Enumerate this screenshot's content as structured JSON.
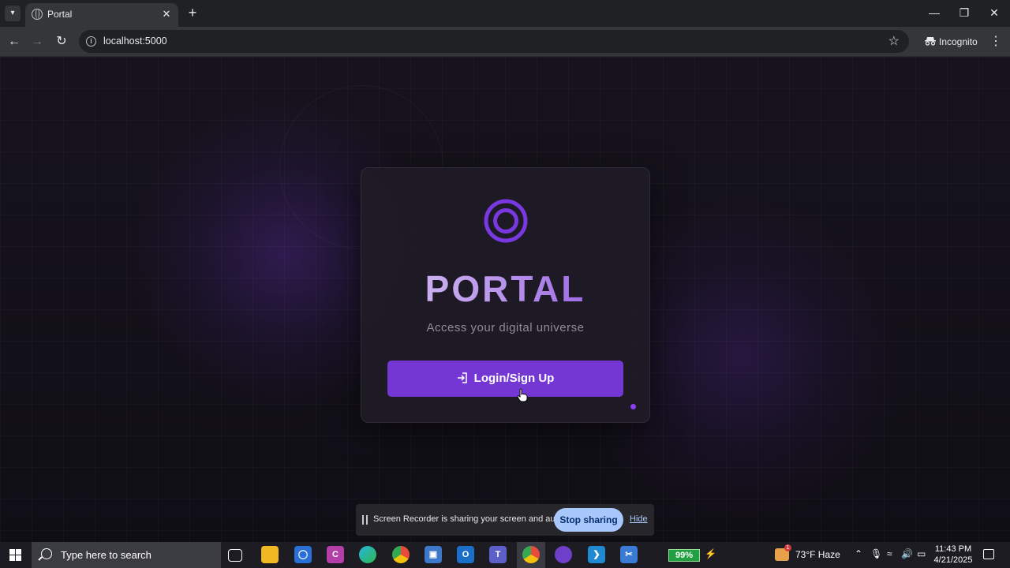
{
  "browser": {
    "tab_title": "Portal",
    "url": "localhost:5000",
    "incognito_label": "Incognito"
  },
  "page": {
    "brand": "PORTAL",
    "tagline": "Access your digital universe",
    "login_button": "Login/Sign Up",
    "accent_color": "#7437d4"
  },
  "share_bar": {
    "message": "Screen Recorder is sharing your screen and audio.",
    "stop_button": "Stop sharing",
    "hide_link": "Hide"
  },
  "taskbar": {
    "search_placeholder": "Type here to search",
    "battery": "99%",
    "weather": "73°F  Haze",
    "weather_badge": "1",
    "time": "11:43 PM",
    "date": "4/21/2025",
    "pinned_apps": [
      "task-view",
      "file-explorer",
      "defender",
      "c-app",
      "edge",
      "chrome",
      "remote-desktop",
      "outlook",
      "teams",
      "chrome-incognito",
      "github-desktop",
      "vscode",
      "snipping-tool"
    ]
  }
}
